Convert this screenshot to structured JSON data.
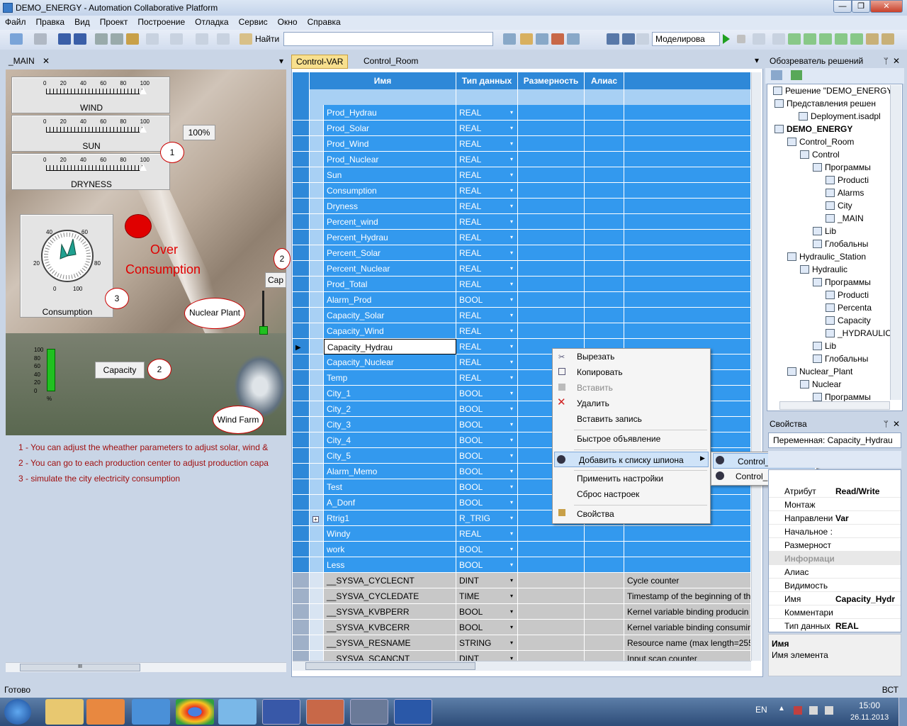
{
  "window": {
    "title": "DEMO_ENERGY - Automation Collaborative Platform",
    "min": "—",
    "max": "❐",
    "close": "✕"
  },
  "menu": [
    "Файл",
    "Правка",
    "Вид",
    "Проект",
    "Построение",
    "Отладка",
    "Сервис",
    "Окно",
    "Справка"
  ],
  "toolbar": {
    "find_label": "Найти",
    "find_value": "",
    "mode_value": "Моделирова"
  },
  "left_panel": {
    "tab": "_MAIN",
    "gauges": [
      {
        "label": "WIND"
      },
      {
        "label": "SUN"
      },
      {
        "label": "DRYNESS"
      }
    ],
    "ticks": [
      "0",
      "20",
      "40",
      "60",
      "80",
      "100"
    ],
    "pct_button": "100%",
    "circle_labels": [
      "1",
      "2",
      "3",
      "2"
    ],
    "dial": {
      "label": "Consumption",
      "t40": "40",
      "t60": "60",
      "t20": "20",
      "t80": "80",
      "t0": "0",
      "t100": "100"
    },
    "over": "Over",
    "consumption": "Consumption",
    "nuclear": "Nuclear Plant",
    "capacity": "Capacity",
    "wind_farm": "Wind Farm",
    "cap_partial": "Cap",
    "bar_ticks": [
      "100",
      "80",
      "60",
      "40",
      "20",
      "0",
      "%"
    ],
    "notes": [
      "1 - You can adjust the wheather parameters to adjust solar, wind &",
      "2 - You can go to each production center to adjust production capa",
      "3 - simulate the city electricity consumption"
    ],
    "hscroll_label": "III"
  },
  "editor": {
    "tabs": [
      "Control-VAR",
      "Control_Room"
    ],
    "columns": [
      "Имя",
      "Тип данных",
      "Размерность",
      "Алиас"
    ],
    "rows": [
      {
        "name": "Prod_Hydrau",
        "type": "REAL"
      },
      {
        "name": "Prod_Solar",
        "type": "REAL"
      },
      {
        "name": "Prod_Wind",
        "type": "REAL"
      },
      {
        "name": "Prod_Nuclear",
        "type": "REAL"
      },
      {
        "name": "Sun",
        "type": "REAL"
      },
      {
        "name": "Consumption",
        "type": "REAL"
      },
      {
        "name": "Dryness",
        "type": "REAL"
      },
      {
        "name": "Percent_wind",
        "type": "REAL"
      },
      {
        "name": "Percent_Hydrau",
        "type": "REAL"
      },
      {
        "name": "Percent_Solar",
        "type": "REAL"
      },
      {
        "name": "Percent_Nuclear",
        "type": "REAL"
      },
      {
        "name": "Prod_Total",
        "type": "REAL"
      },
      {
        "name": "Alarm_Prod",
        "type": "BOOL"
      },
      {
        "name": "Capacity_Solar",
        "type": "REAL"
      },
      {
        "name": "Capacity_Wind",
        "type": "REAL"
      },
      {
        "name": "Capacity_Hydrau",
        "type": "REAL"
      },
      {
        "name": "Capacity_Nuclear",
        "type": "REAL"
      },
      {
        "name": "Temp",
        "type": "REAL"
      },
      {
        "name": "City_1",
        "type": "BOOL"
      },
      {
        "name": "City_2",
        "type": "BOOL"
      },
      {
        "name": "City_3",
        "type": "BOOL"
      },
      {
        "name": "City_4",
        "type": "BOOL"
      },
      {
        "name": "City_5",
        "type": "BOOL"
      },
      {
        "name": "Alarm_Memo",
        "type": "BOOL"
      },
      {
        "name": "Test",
        "type": "BOOL"
      },
      {
        "name": "A_Donf",
        "type": "BOOL"
      },
      {
        "name": "Rtrig1",
        "type": "R_TRIG"
      },
      {
        "name": "Windy",
        "type": "REAL"
      },
      {
        "name": "work",
        "type": "BOOL"
      },
      {
        "name": "Less",
        "type": "BOOL"
      }
    ],
    "sys_rows": [
      {
        "name": "__SYSVA_CYCLECNT",
        "type": "DINT",
        "comment": "Cycle counter"
      },
      {
        "name": "__SYSVA_CYCLEDATE",
        "type": "TIME",
        "comment": "Timestamp of the beginning of th"
      },
      {
        "name": "__SYSVA_KVBPERR",
        "type": "BOOL",
        "comment": "Kernel variable binding producin"
      },
      {
        "name": "__SYSVA_KVBCERR",
        "type": "BOOL",
        "comment": "Kernel variable binding consumir"
      },
      {
        "name": "__SYSVA_RESNAME",
        "type": "STRING",
        "comment": "Resource name (max length=255"
      },
      {
        "name": "__SYSVA_SCANCNT",
        "type": "DINT",
        "comment": "Input scan counter"
      }
    ]
  },
  "context_menu": {
    "items": [
      "Вырезать",
      "Копировать",
      "Вставить",
      "Удалить",
      "Вставить запись",
      "Быстрое объявление",
      "Добавить к списку шпиона",
      "Применить настройки",
      "Сброс настроек",
      "Свойства"
    ],
    "submenu": [
      "Control_Room",
      "Control_Room"
    ]
  },
  "solution": {
    "title": "Обозреватель решений",
    "nodes": [
      "Решение \"DEMO_ENERGY",
      "Представления решен",
      "Deployment.isadpl",
      "DEMO_ENERGY",
      "Control_Room",
      "Control",
      "Программы",
      "Producti",
      "Alarms",
      "City",
      "_MAIN",
      "Lib",
      "Глобальны",
      "Hydraulic_Station",
      "Hydraulic",
      "Программы",
      "Producti",
      "Percenta",
      "Capacity",
      "_HYDRAULIC",
      "Lib",
      "Глобальны",
      "Nuclear_Plant",
      "Nuclear",
      "Программы"
    ]
  },
  "properties": {
    "title": "Свойства",
    "selector": "Переменная: Capacity_Hydrau",
    "rows": [
      {
        "k": "Атрибут",
        "v": "Read/Write"
      },
      {
        "k": "Монтаж",
        "v": ""
      },
      {
        "k": "Направлени",
        "v": "Var"
      },
      {
        "k": "Начальное :",
        "v": ""
      },
      {
        "k": "Размерност",
        "v": ""
      },
      {
        "k": "Информация",
        "v": ""
      },
      {
        "k": "Алиас",
        "v": ""
      },
      {
        "k": "Видимость",
        "v": ""
      },
      {
        "k": "Имя",
        "v": "Capacity_Hydr"
      },
      {
        "k": "Комментари",
        "v": ""
      },
      {
        "k": "Тип данных",
        "v": "REAL"
      }
    ],
    "desc_title": "Имя",
    "desc_text": "Имя элемента"
  },
  "status": {
    "left": "Готово",
    "right": "ВСТ"
  },
  "tray": {
    "lang": "EN",
    "time": "15:00",
    "date": "26.11.2013"
  }
}
